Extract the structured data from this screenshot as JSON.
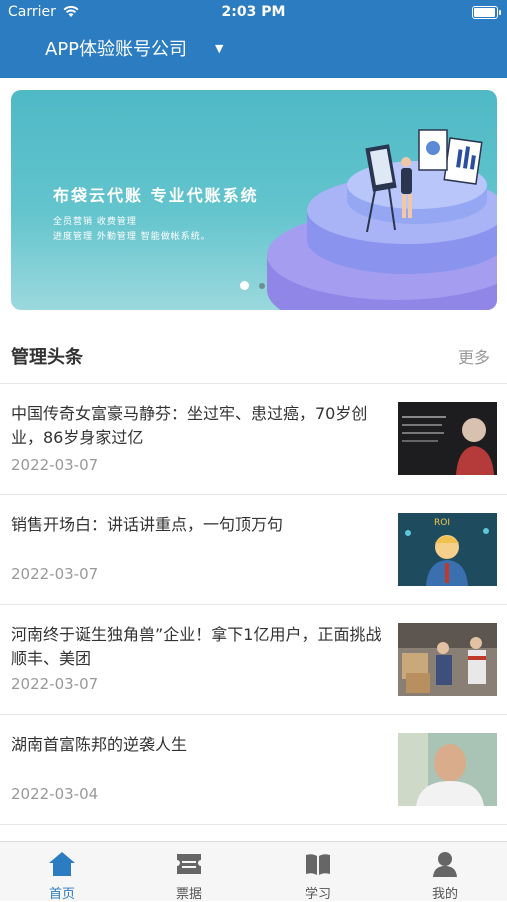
{
  "status_bar": {
    "carrier": "Carrier",
    "time": "2:03 PM"
  },
  "header": {
    "company": "APP体验账号公司",
    "dropdown_icon": "caret-down-icon"
  },
  "banner": {
    "title": "布袋云代账  专业代账系统",
    "line1": "全员营销  收费管理",
    "line2": "进度管理  外勤管理  智能做帐系统。",
    "page_count": 2,
    "active_page": 1
  },
  "section": {
    "title": "管理头条",
    "more": "更多"
  },
  "news": [
    {
      "title": "中国传奇女富豪马静芬：坐过牢、患过癌，70岁创业，86岁身家过亿",
      "date": "2022-03-07"
    },
    {
      "title": "销售开场白：讲话讲重点，一句顶万句",
      "date": "2022-03-07"
    },
    {
      "title": "河南终于诞生独角兽”企业！拿下1亿用户，正面挑战顺丰、美团",
      "date": "2022-03-07"
    },
    {
      "title": "湖南首富陈邦的逆袭人生",
      "date": "2022-03-04"
    }
  ],
  "tabs": [
    {
      "label": "首页",
      "icon": "home-icon",
      "active": true
    },
    {
      "label": "票据",
      "icon": "ticket-icon",
      "active": false
    },
    {
      "label": "学习",
      "icon": "book-icon",
      "active": false
    },
    {
      "label": "我的",
      "icon": "person-icon",
      "active": false
    }
  ],
  "colors": {
    "primary": "#2b7cc0",
    "banner": "#4eb9c5",
    "text": "#333333",
    "muted": "#999999"
  }
}
